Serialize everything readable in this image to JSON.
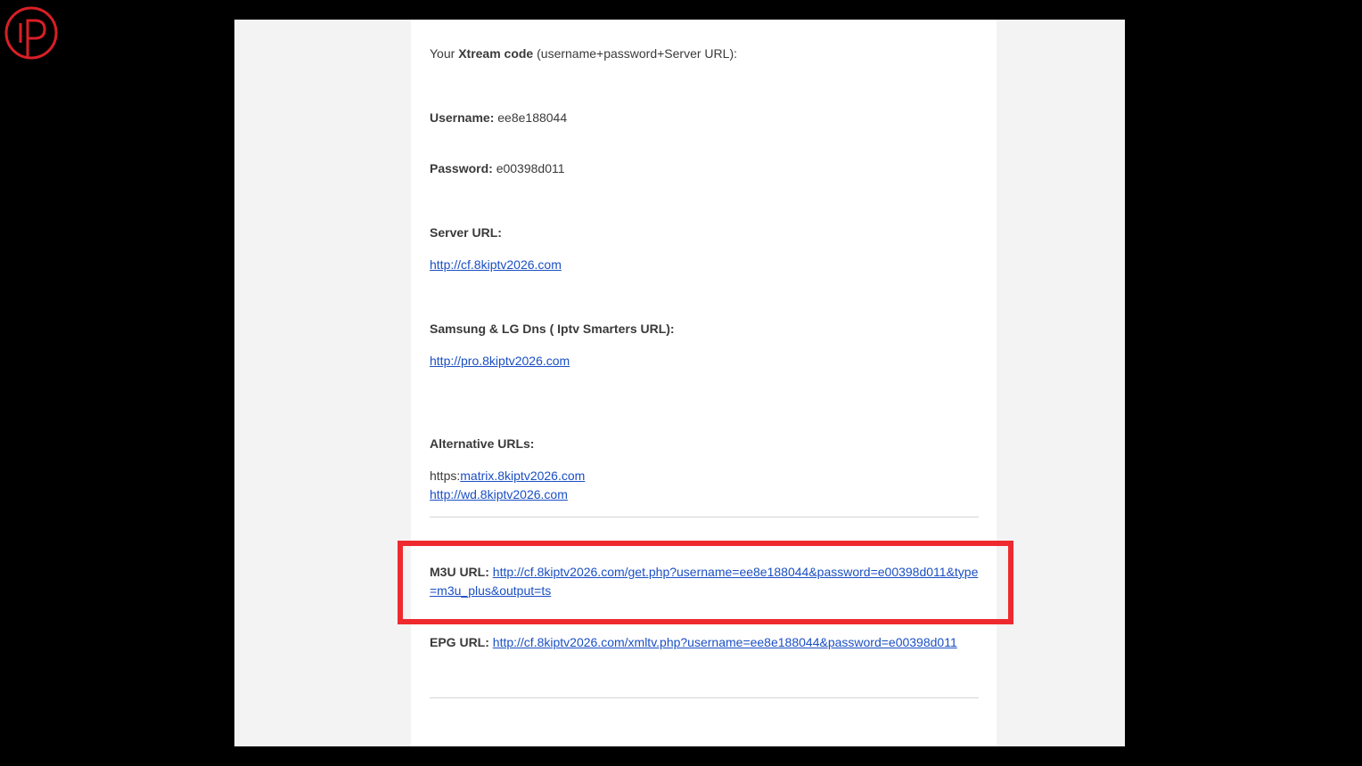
{
  "email": {
    "intro": {
      "prefix": "Your ",
      "bold": "Xtream code",
      "suffix": " (username+password+Server URL):"
    },
    "username": {
      "label": "Username:",
      "value": "ee8e188044"
    },
    "password": {
      "label": "Password:",
      "value": "e00398d011"
    },
    "server": {
      "label": "Server URL:",
      "link": "http://cf.8kiptv2026.com"
    },
    "samsung": {
      "label": "Samsung & LG Dns ( Iptv Smarters URL):",
      "link": "http://pro.8kiptv2026.com"
    },
    "alternative": {
      "label": "Alternative URLs:",
      "prefix": "https:",
      "link1": "matrix.8kiptv2026.com",
      "link2": "http://wd.8kiptv2026.com"
    },
    "m3u": {
      "label": "M3U URL:",
      "link": "http://cf.8kiptv2026.com/get.php?username=ee8e188044&password=e00398d011&type=m3u_plus&output=ts"
    },
    "epg": {
      "label": "EPG URL:",
      "link": "http://cf.8kiptv2026.com/xmltv.php?username=ee8e188044&password=e00398d011"
    }
  },
  "colors": {
    "background": "#000000",
    "highlight": "#ee2a2f",
    "link": "#1a4fc4",
    "logo": "#d81f26"
  },
  "icons": {
    "logo": "iptv-logo-icon"
  }
}
